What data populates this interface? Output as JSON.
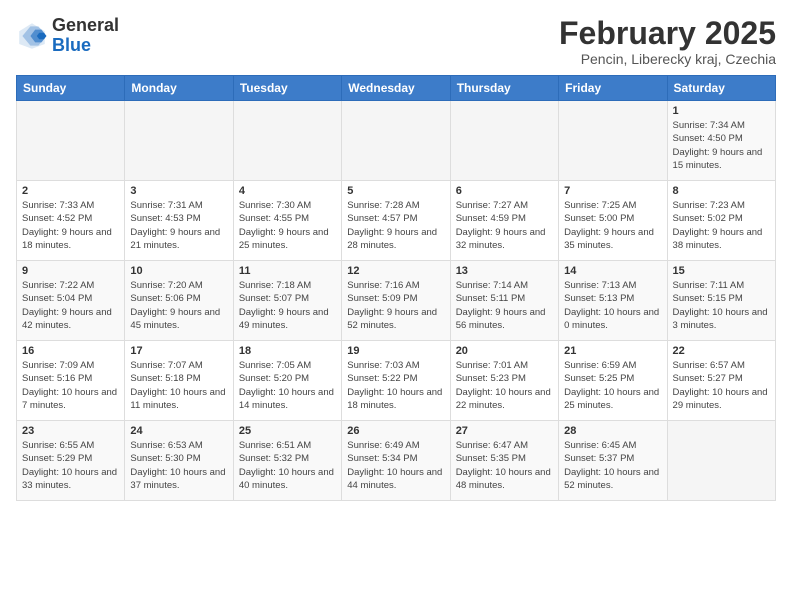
{
  "header": {
    "logo_line1": "General",
    "logo_line2": "Blue",
    "month": "February 2025",
    "location": "Pencin, Liberecky kraj, Czechia"
  },
  "weekdays": [
    "Sunday",
    "Monday",
    "Tuesday",
    "Wednesday",
    "Thursday",
    "Friday",
    "Saturday"
  ],
  "weeks": [
    [
      {
        "day": "",
        "info": ""
      },
      {
        "day": "",
        "info": ""
      },
      {
        "day": "",
        "info": ""
      },
      {
        "day": "",
        "info": ""
      },
      {
        "day": "",
        "info": ""
      },
      {
        "day": "",
        "info": ""
      },
      {
        "day": "1",
        "info": "Sunrise: 7:34 AM\nSunset: 4:50 PM\nDaylight: 9 hours and 15 minutes."
      }
    ],
    [
      {
        "day": "2",
        "info": "Sunrise: 7:33 AM\nSunset: 4:52 PM\nDaylight: 9 hours and 18 minutes."
      },
      {
        "day": "3",
        "info": "Sunrise: 7:31 AM\nSunset: 4:53 PM\nDaylight: 9 hours and 21 minutes."
      },
      {
        "day": "4",
        "info": "Sunrise: 7:30 AM\nSunset: 4:55 PM\nDaylight: 9 hours and 25 minutes."
      },
      {
        "day": "5",
        "info": "Sunrise: 7:28 AM\nSunset: 4:57 PM\nDaylight: 9 hours and 28 minutes."
      },
      {
        "day": "6",
        "info": "Sunrise: 7:27 AM\nSunset: 4:59 PM\nDaylight: 9 hours and 32 minutes."
      },
      {
        "day": "7",
        "info": "Sunrise: 7:25 AM\nSunset: 5:00 PM\nDaylight: 9 hours and 35 minutes."
      },
      {
        "day": "8",
        "info": "Sunrise: 7:23 AM\nSunset: 5:02 PM\nDaylight: 9 hours and 38 minutes."
      }
    ],
    [
      {
        "day": "9",
        "info": "Sunrise: 7:22 AM\nSunset: 5:04 PM\nDaylight: 9 hours and 42 minutes."
      },
      {
        "day": "10",
        "info": "Sunrise: 7:20 AM\nSunset: 5:06 PM\nDaylight: 9 hours and 45 minutes."
      },
      {
        "day": "11",
        "info": "Sunrise: 7:18 AM\nSunset: 5:07 PM\nDaylight: 9 hours and 49 minutes."
      },
      {
        "day": "12",
        "info": "Sunrise: 7:16 AM\nSunset: 5:09 PM\nDaylight: 9 hours and 52 minutes."
      },
      {
        "day": "13",
        "info": "Sunrise: 7:14 AM\nSunset: 5:11 PM\nDaylight: 9 hours and 56 minutes."
      },
      {
        "day": "14",
        "info": "Sunrise: 7:13 AM\nSunset: 5:13 PM\nDaylight: 10 hours and 0 minutes."
      },
      {
        "day": "15",
        "info": "Sunrise: 7:11 AM\nSunset: 5:15 PM\nDaylight: 10 hours and 3 minutes."
      }
    ],
    [
      {
        "day": "16",
        "info": "Sunrise: 7:09 AM\nSunset: 5:16 PM\nDaylight: 10 hours and 7 minutes."
      },
      {
        "day": "17",
        "info": "Sunrise: 7:07 AM\nSunset: 5:18 PM\nDaylight: 10 hours and 11 minutes."
      },
      {
        "day": "18",
        "info": "Sunrise: 7:05 AM\nSunset: 5:20 PM\nDaylight: 10 hours and 14 minutes."
      },
      {
        "day": "19",
        "info": "Sunrise: 7:03 AM\nSunset: 5:22 PM\nDaylight: 10 hours and 18 minutes."
      },
      {
        "day": "20",
        "info": "Sunrise: 7:01 AM\nSunset: 5:23 PM\nDaylight: 10 hours and 22 minutes."
      },
      {
        "day": "21",
        "info": "Sunrise: 6:59 AM\nSunset: 5:25 PM\nDaylight: 10 hours and 25 minutes."
      },
      {
        "day": "22",
        "info": "Sunrise: 6:57 AM\nSunset: 5:27 PM\nDaylight: 10 hours and 29 minutes."
      }
    ],
    [
      {
        "day": "23",
        "info": "Sunrise: 6:55 AM\nSunset: 5:29 PM\nDaylight: 10 hours and 33 minutes."
      },
      {
        "day": "24",
        "info": "Sunrise: 6:53 AM\nSunset: 5:30 PM\nDaylight: 10 hours and 37 minutes."
      },
      {
        "day": "25",
        "info": "Sunrise: 6:51 AM\nSunset: 5:32 PM\nDaylight: 10 hours and 40 minutes."
      },
      {
        "day": "26",
        "info": "Sunrise: 6:49 AM\nSunset: 5:34 PM\nDaylight: 10 hours and 44 minutes."
      },
      {
        "day": "27",
        "info": "Sunrise: 6:47 AM\nSunset: 5:35 PM\nDaylight: 10 hours and 48 minutes."
      },
      {
        "day": "28",
        "info": "Sunrise: 6:45 AM\nSunset: 5:37 PM\nDaylight: 10 hours and 52 minutes."
      },
      {
        "day": "",
        "info": ""
      }
    ]
  ]
}
